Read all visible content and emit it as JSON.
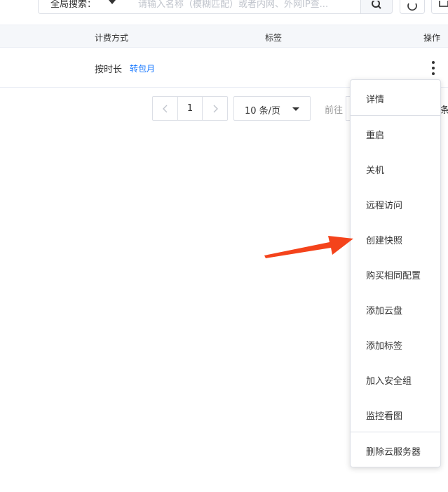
{
  "toolbar": {
    "search_scope": "全局搜索：",
    "search_placeholder": "请输入名称（模糊匹配）或者内网、外网IP查..."
  },
  "table": {
    "headers": {
      "billing": "计费方式",
      "tags": "标签",
      "actions": "操作"
    },
    "rows": [
      {
        "billing": "按时长",
        "billing_link": "转包月"
      }
    ]
  },
  "pagination": {
    "current_page": "1",
    "page_size": "10 条/页",
    "goto_label": "前往",
    "tail_text": "条"
  },
  "action_menu": {
    "items": [
      "详情",
      "重启",
      "关机",
      "远程访问",
      "创建快照",
      "购买相同配置",
      "添加云盘",
      "添加标签",
      "加入安全组",
      "监控看图",
      "删除云服务器"
    ]
  },
  "colors": {
    "link": "#1677ff",
    "arrow": "#f4431b",
    "border": "#dcdfe6",
    "header_bg": "#f5f7fa"
  }
}
